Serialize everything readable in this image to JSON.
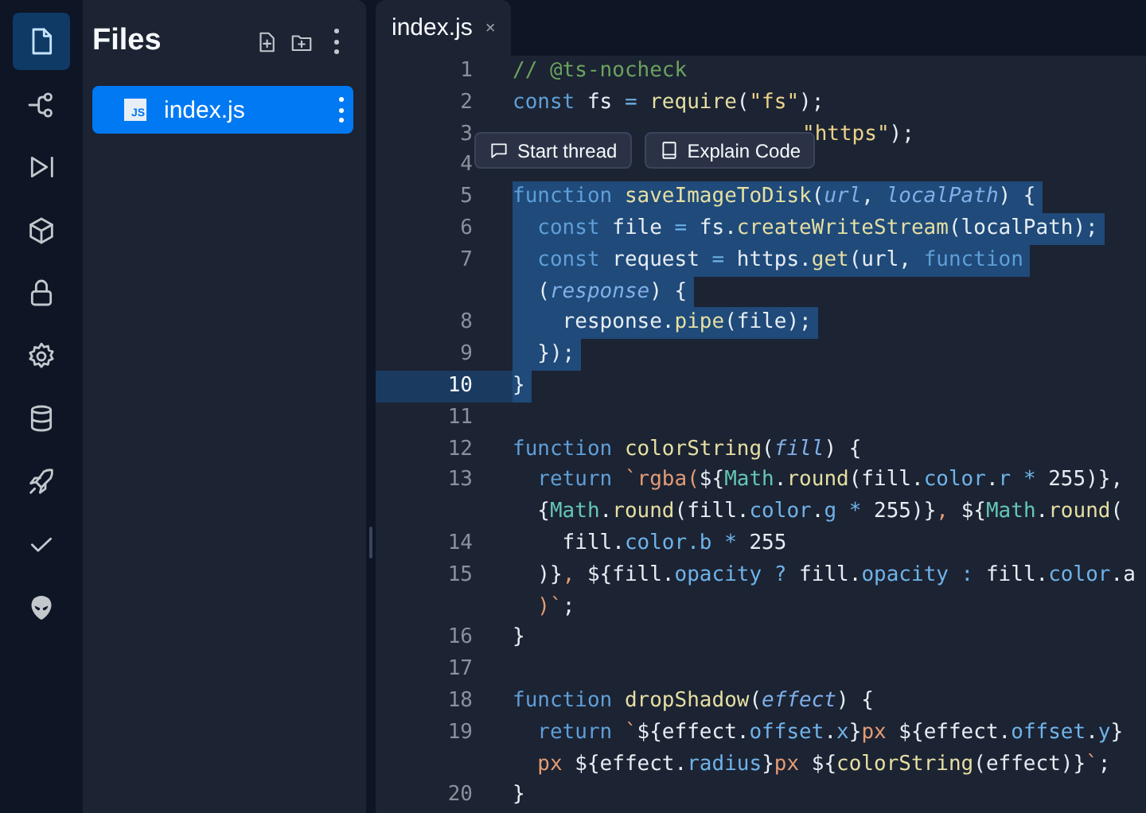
{
  "rail": [
    {
      "kind": "file",
      "selected": true
    },
    {
      "kind": "branch",
      "selected": false
    },
    {
      "kind": "run",
      "selected": false
    },
    {
      "kind": "box",
      "selected": false
    },
    {
      "kind": "lock",
      "selected": false
    },
    {
      "kind": "gear",
      "selected": false
    },
    {
      "kind": "database",
      "selected": false
    },
    {
      "kind": "rocket",
      "selected": false
    },
    {
      "kind": "check",
      "selected": false
    },
    {
      "kind": "alien",
      "selected": false
    }
  ],
  "files": {
    "title": "Files",
    "items": [
      {
        "name": "index.js",
        "badge": "JS",
        "selected": true
      }
    ]
  },
  "tabs": [
    {
      "label": "index.js",
      "close": "×",
      "selected": true
    }
  ],
  "toolbar": [
    {
      "label": "Start thread",
      "kind": "comment"
    },
    {
      "label": "Explain Code",
      "kind": "book"
    }
  ],
  "lines": [
    {
      "number": "1",
      "selected": false,
      "active": false,
      "tokens": [
        {
          "text": "// @ts-nocheck",
          "kind": "cm"
        }
      ]
    },
    {
      "number": "2",
      "selected": false,
      "active": false,
      "tokens": [
        {
          "text": "const",
          "kind": "kw"
        },
        {
          "text": " fs ",
          "kind": "p"
        },
        {
          "text": "=",
          "kind": "op"
        },
        {
          "text": " require",
          "kind": "fn"
        },
        {
          "text": "(",
          "kind": "p"
        },
        {
          "text": "\"fs\"",
          "kind": "str"
        },
        {
          "text": ");",
          "kind": "p"
        }
      ]
    },
    {
      "number": "3",
      "selected": false,
      "active": false,
      "kind": "covered",
      "tokens": [
        {
          "text": "\"https\"",
          "kind": "str"
        },
        {
          "text": ");",
          "kind": "p"
        }
      ]
    },
    {
      "number": "4",
      "selected": false,
      "active": false
    },
    {
      "number": "5",
      "selected": true,
      "active": false,
      "tokens": [
        {
          "text": "function",
          "kind": "kw"
        },
        {
          "text": " saveImageToDisk",
          "kind": "fn"
        },
        {
          "text": "(",
          "kind": "p"
        },
        {
          "text": "url",
          "kind": "param"
        },
        {
          "text": ", ",
          "kind": "p"
        },
        {
          "text": "localPath",
          "kind": "param"
        },
        {
          "text": ") {",
          "kind": "p"
        }
      ]
    },
    {
      "number": "6",
      "selected": true,
      "active": false,
      "tokens": [
        {
          "text": "  const",
          "kind": "kw"
        },
        {
          "text": " file ",
          "kind": "p"
        },
        {
          "text": "=",
          "kind": "op"
        },
        {
          "text": " fs.",
          "kind": "p"
        },
        {
          "text": "createWriteStream",
          "kind": "fn"
        },
        {
          "text": "(localPath);",
          "kind": "p"
        }
      ]
    },
    {
      "number": "7",
      "selected": true,
      "active": false,
      "tokens": [
        {
          "text": "  const",
          "kind": "kw"
        },
        {
          "text": " request ",
          "kind": "p"
        },
        {
          "text": "=",
          "kind": "op"
        },
        {
          "text": " https.",
          "kind": "p"
        },
        {
          "text": "get",
          "kind": "fn"
        },
        {
          "text": "(url, ",
          "kind": "p"
        },
        {
          "text": "function",
          "kind": "kw"
        }
      ]
    },
    {
      "selected": true,
      "active": false,
      "tokens": [
        {
          "text": "  (",
          "kind": "p"
        },
        {
          "text": "response",
          "kind": "param"
        },
        {
          "text": ") {",
          "kind": "p"
        }
      ]
    },
    {
      "number": "8",
      "selected": true,
      "active": false,
      "tokens": [
        {
          "text": "    response.",
          "kind": "p"
        },
        {
          "text": "pipe",
          "kind": "fn"
        },
        {
          "text": "(file);",
          "kind": "p"
        }
      ]
    },
    {
      "number": "9",
      "selected": true,
      "active": false,
      "tokens": [
        {
          "text": "  });",
          "kind": "p"
        }
      ]
    },
    {
      "number": "10",
      "selected": true,
      "active": true,
      "tokens": [
        {
          "text": "}",
          "kind": "p"
        }
      ]
    },
    {
      "number": "11",
      "selected": false,
      "active": false
    },
    {
      "number": "12",
      "selected": false,
      "active": false,
      "tokens": [
        {
          "text": "function",
          "kind": "kw"
        },
        {
          "text": " colorString",
          "kind": "fn"
        },
        {
          "text": "(",
          "kind": "p"
        },
        {
          "text": "fill",
          "kind": "param"
        },
        {
          "text": ") {",
          "kind": "p"
        }
      ]
    },
    {
      "number": "13",
      "selected": false,
      "active": false,
      "tokens": [
        {
          "text": "  return",
          "kind": "kw"
        },
        {
          "text": " `rgba(",
          "kind": "tpl"
        },
        {
          "text": "${",
          "kind": "p"
        },
        {
          "text": "Math",
          "kind": "cls"
        },
        {
          "text": ".",
          "kind": "p"
        },
        {
          "text": "round",
          "kind": "fn"
        },
        {
          "text": "(fill.",
          "kind": "p"
        },
        {
          "text": "color",
          "kind": "prop"
        },
        {
          "text": ".",
          "kind": "p"
        },
        {
          "text": "r",
          "kind": "prop"
        },
        {
          "text": " *",
          "kind": "op"
        },
        {
          "text": " 255)},",
          "kind": "p"
        }
      ]
    },
    {
      "selected": false,
      "active": false,
      "tokens": [
        {
          "text": "  {",
          "kind": "p"
        },
        {
          "text": "Math",
          "kind": "cls"
        },
        {
          "text": ".",
          "kind": "p"
        },
        {
          "text": "round",
          "kind": "fn"
        },
        {
          "text": "(fill.",
          "kind": "p"
        },
        {
          "text": "color",
          "kind": "prop"
        },
        {
          "text": ".",
          "kind": "p"
        },
        {
          "text": "g",
          "kind": "prop"
        },
        {
          "text": " *",
          "kind": "op"
        },
        {
          "text": " 255)}",
          "kind": "p"
        },
        {
          "text": ", ",
          "kind": "tpl"
        },
        {
          "text": "${",
          "kind": "p"
        },
        {
          "text": "Math",
          "kind": "cls"
        },
        {
          "text": ".",
          "kind": "p"
        },
        {
          "text": "round",
          "kind": "fn"
        },
        {
          "text": "(",
          "kind": "p"
        }
      ]
    },
    {
      "number": "14",
      "selected": false,
      "active": false,
      "tokens": [
        {
          "text": "    fill.",
          "kind": "p"
        },
        {
          "text": "color",
          "kind": "prop"
        },
        {
          "text": ".b",
          "kind": "prop"
        },
        {
          "text": " *",
          "kind": "op"
        },
        {
          "text": " 255",
          "kind": "p"
        }
      ]
    },
    {
      "number": "15",
      "selected": false,
      "active": false,
      "tokens": [
        {
          "text": "  )}",
          "kind": "p"
        },
        {
          "text": ", ",
          "kind": "tpl"
        },
        {
          "text": "${fill.",
          "kind": "p"
        },
        {
          "text": "opacity",
          "kind": "prop"
        },
        {
          "text": " ?",
          "kind": "op"
        },
        {
          "text": " fill.",
          "kind": "p"
        },
        {
          "text": "opacity",
          "kind": "prop"
        },
        {
          "text": " :",
          "kind": "op"
        },
        {
          "text": " fill.",
          "kind": "p"
        },
        {
          "text": "color",
          "kind": "prop"
        },
        {
          "text": ".a",
          "kind": "p"
        }
      ]
    },
    {
      "selected": false,
      "active": false,
      "tokens": [
        {
          "text": "  )`",
          "kind": "tpl"
        },
        {
          "text": ";",
          "kind": "p"
        }
      ]
    },
    {
      "number": "16",
      "selected": false,
      "active": false,
      "tokens": [
        {
          "text": "}",
          "kind": "p"
        }
      ]
    },
    {
      "number": "17",
      "selected": false,
      "active": false
    },
    {
      "number": "18",
      "selected": false,
      "active": false,
      "tokens": [
        {
          "text": "function",
          "kind": "kw"
        },
        {
          "text": " dropShadow",
          "kind": "fn"
        },
        {
          "text": "(",
          "kind": "p"
        },
        {
          "text": "effect",
          "kind": "param"
        },
        {
          "text": ") {",
          "kind": "p"
        }
      ]
    },
    {
      "number": "19",
      "selected": false,
      "active": false,
      "tokens": [
        {
          "text": "  return",
          "kind": "kw"
        },
        {
          "text": " `",
          "kind": "tpl"
        },
        {
          "text": "${effect.",
          "kind": "p"
        },
        {
          "text": "offset",
          "kind": "prop"
        },
        {
          "text": ".",
          "kind": "p"
        },
        {
          "text": "x",
          "kind": "prop"
        },
        {
          "text": "}",
          "kind": "p"
        },
        {
          "text": "px ",
          "kind": "tpl"
        },
        {
          "text": "${effect.",
          "kind": "p"
        },
        {
          "text": "offset",
          "kind": "prop"
        },
        {
          "text": ".",
          "kind": "p"
        },
        {
          "text": "y",
          "kind": "prop"
        },
        {
          "text": "}",
          "kind": "p"
        }
      ]
    },
    {
      "selected": false,
      "active": false,
      "tokens": [
        {
          "text": "  px ",
          "kind": "tpl"
        },
        {
          "text": "${effect.",
          "kind": "p"
        },
        {
          "text": "radius",
          "kind": "prop"
        },
        {
          "text": "}",
          "kind": "p"
        },
        {
          "text": "px ",
          "kind": "tpl"
        },
        {
          "text": "${",
          "kind": "p"
        },
        {
          "text": "colorString",
          "kind": "fn"
        },
        {
          "text": "(effect)}",
          "kind": "p"
        },
        {
          "text": "`",
          "kind": "tpl"
        },
        {
          "text": ";",
          "kind": "p"
        }
      ]
    },
    {
      "number": "20",
      "selected": false,
      "active": false,
      "tokens": [
        {
          "text": "}",
          "kind": "p"
        }
      ]
    }
  ]
}
